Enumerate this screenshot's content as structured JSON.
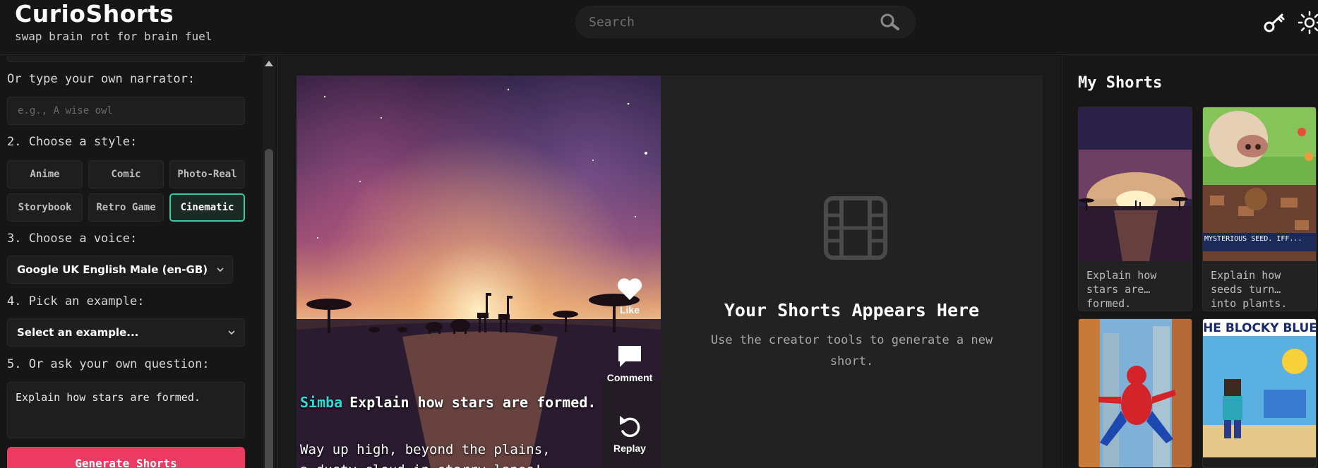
{
  "header": {
    "title": "CurioShorts",
    "tagline": "swap brain rot for brain fuel",
    "search_placeholder": "Search"
  },
  "sidebar": {
    "narrator_label": "Or type your own narrator:",
    "narrator_placeholder": "e.g., A wise owl",
    "style_label": "2. Choose a style:",
    "styles": [
      "Anime",
      "Comic",
      "Photo-Real",
      "Storybook",
      "Retro Game",
      "Cinematic"
    ],
    "active_style": "Cinematic",
    "voice_label": "3. Choose a voice:",
    "voice_value": "Google UK English Male (en-GB)",
    "example_label": "4. Pick an example:",
    "example_value": "Select an example...",
    "question_label": "5. Or ask your own question:",
    "question_value": "Explain how stars are formed.",
    "generate_label": "Generate Shorts"
  },
  "video": {
    "narrator_name": "Simba",
    "title": "Explain how stars are formed.",
    "line1": "Way up high, beyond the plains,",
    "line2": "a dusty cloud in starry lanes!",
    "like_label": "Like",
    "comment_label": "Comment",
    "replay_label": "Replay"
  },
  "empty": {
    "title": "Your Shorts Appears Here",
    "subtitle": "Use the creator tools to generate a new short."
  },
  "my_shorts": {
    "title": "My Shorts",
    "cards": [
      {
        "text": "Explain how stars are… formed."
      },
      {
        "text": "Explain how seeds turn… into plants.",
        "banner": "MYSTERIOUS SEED. IFF..."
      },
      {
        "text": ""
      },
      {
        "text": "",
        "banner": "HE BLOCKY BLUE"
      }
    ]
  },
  "colors": {
    "accent": "#3ec7a1",
    "generate": "#ec3b63",
    "narrator_name": "#35d8d5"
  }
}
